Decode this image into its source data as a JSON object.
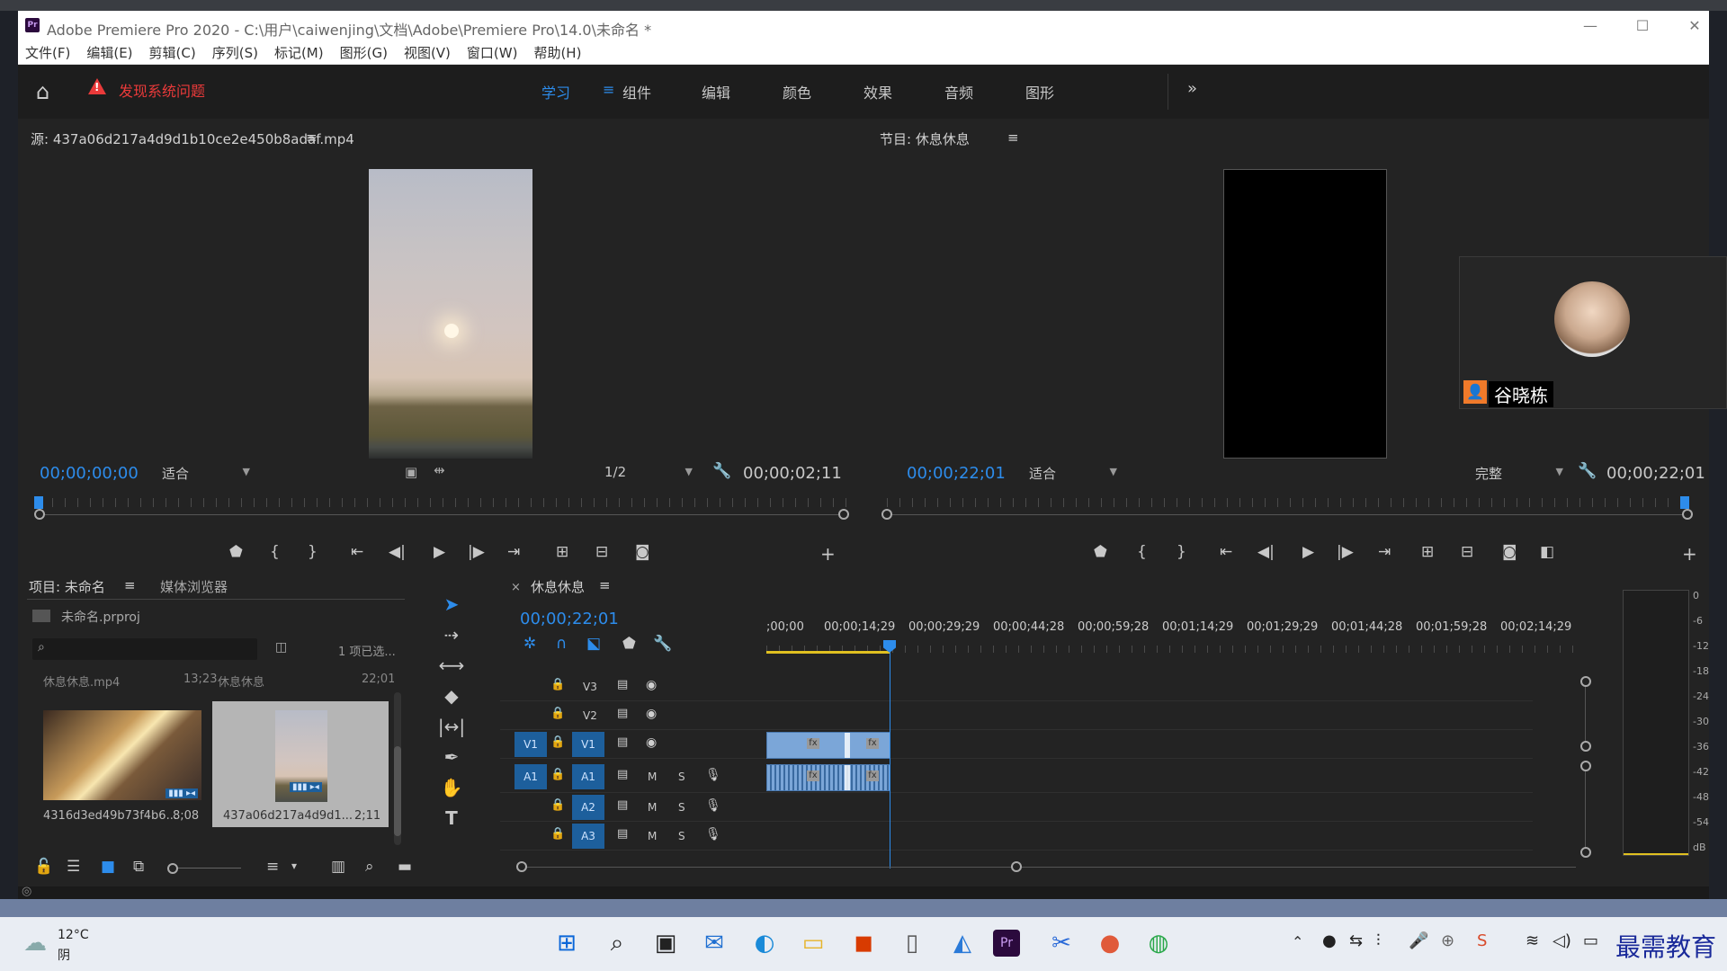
{
  "window": {
    "title": "Adobe Premiere Pro 2020 - C:\\用户\\caiwenjing\\文档\\Adobe\\Premiere Pro\\14.0\\未命名 *",
    "app_badge": "Pr",
    "minimize": "—",
    "maximize": "☐",
    "close": "✕"
  },
  "menu": [
    "文件(F)",
    "编辑(E)",
    "剪辑(C)",
    "序列(S)",
    "标记(M)",
    "图形(G)",
    "视图(V)",
    "窗口(W)",
    "帮助(H)"
  ],
  "workspace": {
    "warning": "发现系统问题",
    "tabs": [
      "学习",
      "组件",
      "编辑",
      "颜色",
      "效果",
      "音频",
      "图形"
    ],
    "active_tab": "学习",
    "menu_icon": "≡",
    "more": "»"
  },
  "source": {
    "title": "源: 437a06d217a4d9d1b10ce2e450b8adaf.mp4",
    "menu": "≡",
    "timecode_in": "00;00;00;00",
    "fit": "适合",
    "resolution": "1/2",
    "duration": "00;00;02;11"
  },
  "program": {
    "title": "节目: 休息休息",
    "menu": "≡",
    "timecode": "00;00;22;01",
    "fit": "适合",
    "quality": "完整",
    "duration": "00;00;22;01"
  },
  "overlay": {
    "user": "谷晓栋"
  },
  "project": {
    "tab_project": "项目: 未命名",
    "menu": "≡",
    "tab_media": "媒体浏览器",
    "file": "未命名.prproj",
    "selection": "1 项已选...",
    "search_placeholder": "",
    "items": [
      {
        "name": "休息休息.mp4",
        "dur": "13;23",
        "thumb": "4316d3ed49b73f4b6...",
        "thumb_dur": "8;08"
      },
      {
        "name": "休息休息",
        "dur": "22;01",
        "thumb": "437a06d217a4d9d1...",
        "thumb_dur": "2;11"
      }
    ]
  },
  "timeline": {
    "tab": "休息休息",
    "close": "×",
    "menu": "≡",
    "timecode": "00;00;22;01",
    "ruler": [
      ";00;00",
      "00;00;14;29",
      "00;00;29;29",
      "00;00;44;28",
      "00;00;59;28",
      "00;01;14;29",
      "00;01;29;29",
      "00;01;44;28",
      "00;01;59;28",
      "00;02;14;29"
    ],
    "tracks": [
      {
        "target": "",
        "name": "V3",
        "type": "video"
      },
      {
        "target": "",
        "name": "V2",
        "type": "video"
      },
      {
        "target": "V1",
        "name": "V1",
        "type": "video"
      },
      {
        "target": "A1",
        "name": "A1",
        "type": "audio"
      },
      {
        "target": "",
        "name": "A2",
        "type": "audio"
      },
      {
        "target": "",
        "name": "A3",
        "type": "audio"
      }
    ],
    "mute": "M",
    "solo": "S",
    "fx": "fx"
  },
  "meter": {
    "labels": [
      "0",
      "-6",
      "-12",
      "-18",
      "-24",
      "-30",
      "-36",
      "-42",
      "-48",
      "-54",
      "dB"
    ]
  },
  "taskbar": {
    "temp": "12°C",
    "weather": "阴",
    "watermark": "最需教育"
  }
}
